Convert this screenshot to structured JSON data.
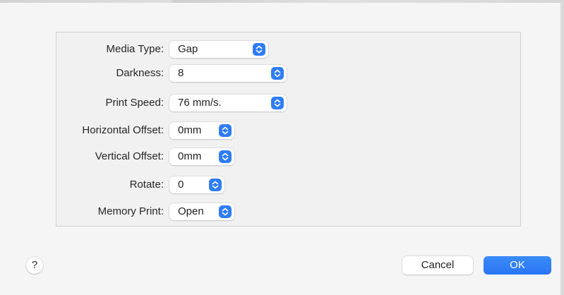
{
  "settings": {
    "media_type": {
      "label": "Media Type:",
      "value": "Gap"
    },
    "darkness": {
      "label": "Darkness:",
      "value": "8"
    },
    "print_speed": {
      "label": "Print Speed:",
      "value": "76 mm/s."
    },
    "horizontal_offset": {
      "label": "Horizontal Offset:",
      "value": "0mm"
    },
    "vertical_offset": {
      "label": "Vertical Offset:",
      "value": "0mm"
    },
    "rotate": {
      "label": "Rotate:",
      "value": "0"
    },
    "memory_print": {
      "label": "Memory Print:",
      "value": "Open"
    }
  },
  "footer": {
    "help_label": "?",
    "cancel_label": "Cancel",
    "ok_label": "OK"
  },
  "icons": {
    "popup_indicator": "chevron-up-down-icon",
    "help": "question-mark-icon"
  },
  "colors": {
    "accent": "#2f7df6",
    "dialog_background": "#f5f5f5",
    "box_background": "#f1f1f1"
  }
}
